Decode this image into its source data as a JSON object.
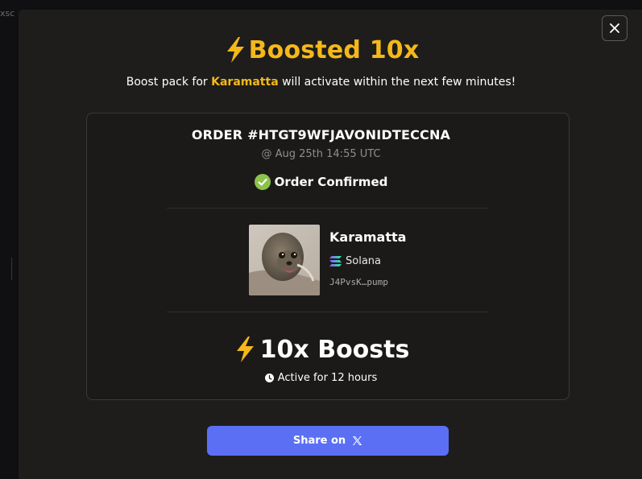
{
  "backdrop": {
    "partial_text": "xsc"
  },
  "modal": {
    "close_icon": "close-icon",
    "title": "Boosted 10x",
    "title_icon": "lightning-icon",
    "subtitle_prefix": "Boost pack for ",
    "subtitle_token": "Karamatta",
    "subtitle_suffix": " will activate within the next few minutes!",
    "accent_color": "#f5b81a"
  },
  "order": {
    "id": "ORDER #HTGT9WFJAVONIDTECCNA",
    "date": "@ Aug 25th 14:55 UTC",
    "status": "Order Confirmed",
    "status_icon": "check-circle-icon",
    "status_color": "#8bc34a"
  },
  "token": {
    "name": "Karamatta",
    "chain": "Solana",
    "chain_icon": "solana-icon",
    "address": "J4PvsK…pump",
    "image_icon": "seal-photo"
  },
  "boost": {
    "label": "10x Boosts",
    "icon": "lightning-icon",
    "duration": "Active for 12 hours",
    "duration_icon": "clock-icon"
  },
  "share": {
    "label": "Share on",
    "icon": "x-logo-icon",
    "color": "#5b6ff5"
  }
}
